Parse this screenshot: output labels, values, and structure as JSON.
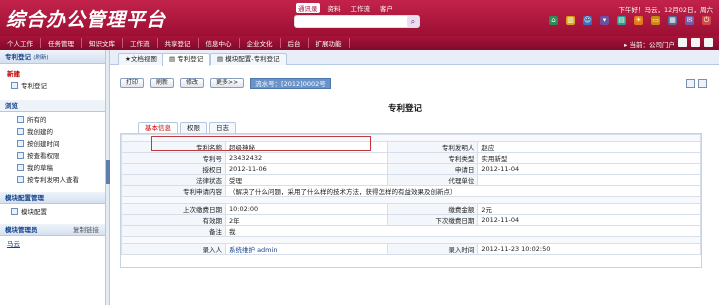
{
  "header": {
    "logo": "综合办公管理平台",
    "search_tabs": [
      "通讯录",
      "资料",
      "工作流",
      "客户"
    ],
    "datetime": "下午好！马云，12月02日，周六"
  },
  "nav": {
    "items": [
      "个人工作",
      "任务管理",
      "知识文库",
      "工作流",
      "共享登记",
      "信息中心",
      "企业文化",
      "后台",
      "扩展功能"
    ],
    "location": "当前：公司门户"
  },
  "sidebar": {
    "title": "专利登记",
    "title_sub": "(刷新)",
    "new_label": "新建",
    "new_item": "专利登记",
    "browse_label": "浏览",
    "tree": [
      "所有的",
      "我创建的",
      "按创建时间",
      "按查看权限",
      "我的草稿",
      "按专利发明人查看"
    ],
    "config_title": "模块配置管理",
    "config_item": "模块配置",
    "admin_title": "模块管理员",
    "admin_link": "复制链接",
    "admin_name": "马云"
  },
  "tabs": {
    "items": [
      "★文档视图",
      "专利登记",
      "模块配置-专利登记"
    ]
  },
  "toolbar": {
    "print": "打印",
    "refresh": "刷新",
    "edit": "修改",
    "more": "更多>>",
    "flow_no": "流水号：[2012]0002号"
  },
  "page_title": "专利登记",
  "form_tabs": [
    "基本信息",
    "权限",
    "日志"
  ],
  "form": {
    "rows": [
      {
        "l1": "专利名称",
        "v1": "超级神秘",
        "l2": "专利发明人",
        "v2": "赵应"
      },
      {
        "l1": "专利号",
        "v1": "23432432",
        "l2": "专利类型",
        "v2": "实用新型"
      },
      {
        "l1": "授权日",
        "v1": "2012-11-06",
        "l2": "申请日",
        "v2": "2012-11-04"
      },
      {
        "l1": "法律状态",
        "v1": "受理",
        "l2": "代理单位",
        "v2": ""
      }
    ],
    "content_label": "专利申请内容",
    "content_value": "（解决了什么问题，采用了什么样的技术方法，获得怎样的有益效果及创新点）",
    "rows2": [
      {
        "l1": "上次缴费日期",
        "v1": "10:02:00",
        "l2": "缴费金额",
        "v2": "2元"
      },
      {
        "l1": "有效期",
        "v1": "2年",
        "l2": "下次缴费日期",
        "v2": "2012-11-04"
      }
    ],
    "remark_label": "备注",
    "remark_value": "我",
    "entry_label": "录入人",
    "entry_value": "系统维护 admin",
    "entry_time_label": "录入时间",
    "entry_time_value": "2012-11-23 10:02:50"
  }
}
